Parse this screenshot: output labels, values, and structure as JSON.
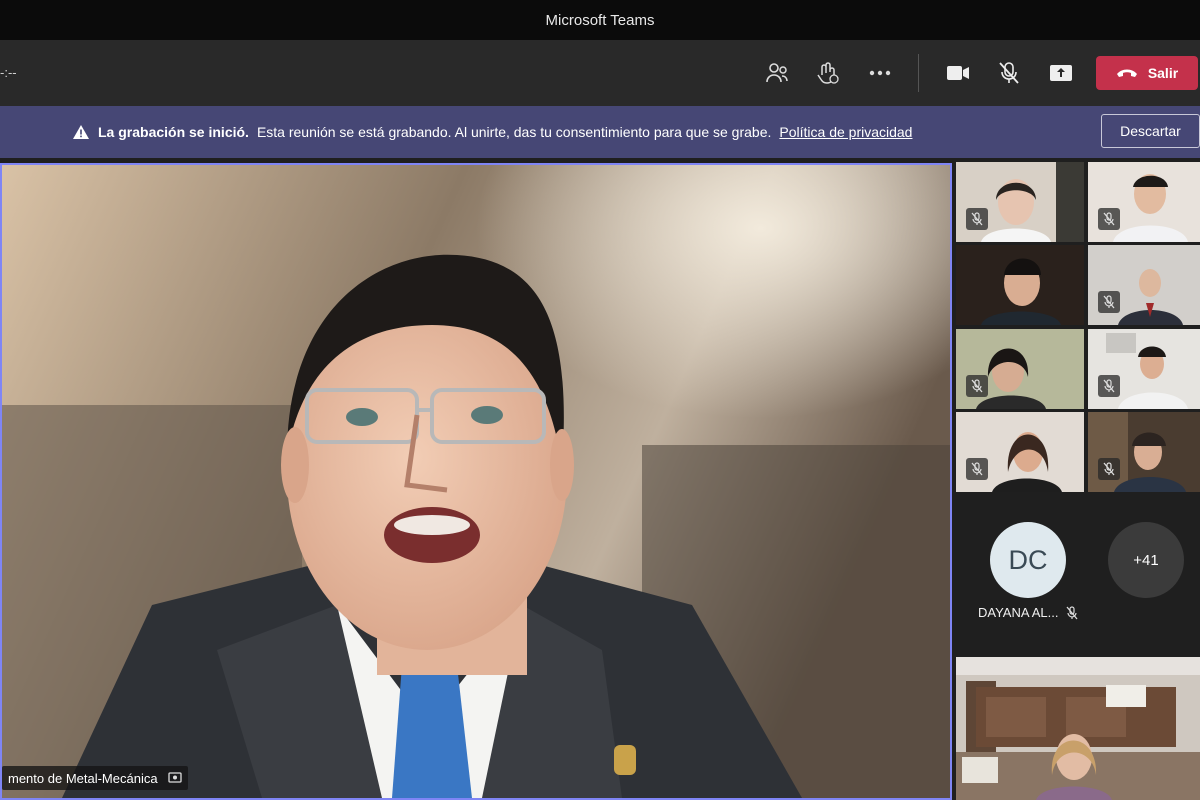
{
  "window": {
    "title": "Microsoft Teams"
  },
  "toolbar": {
    "timer": "-:--",
    "leave_label": "Salir",
    "icons": [
      "participants-icon",
      "reactions-icon",
      "more-icon",
      "camera-icon",
      "mic-off-icon",
      "share-icon",
      "phone-icon"
    ]
  },
  "banner": {
    "bold_text": "La grabación se inició.",
    "text": "Esta reunión se está grabando. Al unirte, das tu consentimiento para que se grabe.",
    "link": "Política de privacidad",
    "dismiss_label": "Descartar"
  },
  "stage": {
    "speaker_name": "mento de Metal-Mecánica"
  },
  "gallery": {
    "avatar_initials": "DC",
    "avatar_name": "DAYANA AL...",
    "overflow_count": "+41"
  },
  "colors": {
    "banner": "#464775",
    "leave": "#c4314b",
    "active_speaker": "#7f85f5"
  }
}
